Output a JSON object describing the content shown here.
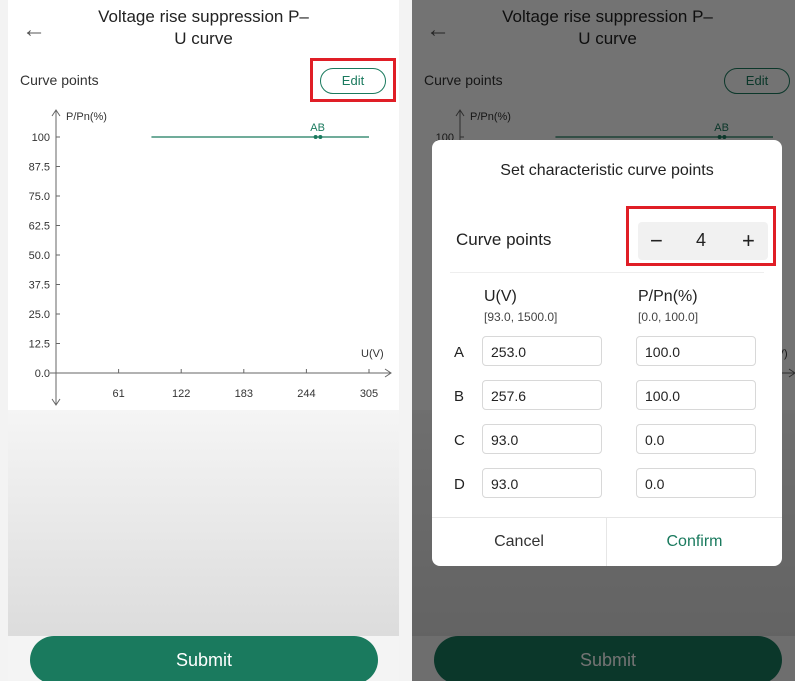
{
  "screen": {
    "title_line1": "Voltage rise suppression P–",
    "title_line2": "U curve",
    "back_icon": "←"
  },
  "card": {
    "curve_points_label": "Curve points",
    "edit_label": "Edit"
  },
  "chart_data": {
    "type": "line",
    "ylabel": "P/Pn(%)",
    "xlabel": "U(V)",
    "yticks": [
      "100",
      "87.5",
      "75.0",
      "62.5",
      "50.0",
      "37.5",
      "25.0",
      "12.5",
      "0.0"
    ],
    "xticks": [
      "61",
      "122",
      "183",
      "244",
      "305"
    ],
    "xlim": [
      0,
      305
    ],
    "ylim": [
      0,
      100
    ],
    "series": [
      {
        "values": [
          [
            93.0,
            100.0
          ],
          [
            305.0,
            100.0
          ]
        ]
      }
    ],
    "points": [
      {
        "label": "AB",
        "x": 253.0,
        "y": 100.0
      },
      {
        "label": "",
        "x": 257.6,
        "y": 100.0
      }
    ]
  },
  "submit_label": "Submit",
  "dialog": {
    "title": "Set characteristic curve points",
    "curve_points_label": "Curve points",
    "minus": "−",
    "count": "4",
    "plus": "+",
    "col_u_header": "U(V)",
    "col_u_range": "[93.0, 1500.0]",
    "col_p_header": "P/Pn(%)",
    "col_p_range": "[0.0, 100.0]",
    "rows": [
      {
        "label": "A",
        "u": "253.0",
        "p": "100.0"
      },
      {
        "label": "B",
        "u": "257.6",
        "p": "100.0"
      },
      {
        "label": "C",
        "u": "93.0",
        "p": "0.0"
      },
      {
        "label": "D",
        "u": "93.0",
        "p": "0.0"
      }
    ],
    "cancel_label": "Cancel",
    "confirm_label": "Confirm"
  },
  "colors": {
    "accent": "#1a7a5e",
    "highlight": "#e01e26"
  }
}
